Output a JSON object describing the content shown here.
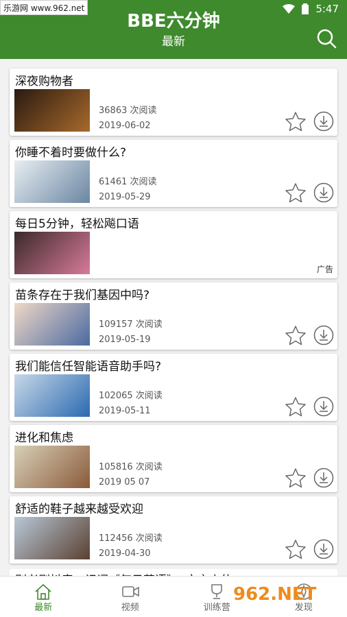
{
  "status_bar": {
    "watermark": "乐游网 www.962.net",
    "time": "5:47"
  },
  "header": {
    "title": "BBE六分钟",
    "subtitle": "最新",
    "search_icon": "search-icon"
  },
  "articles": [
    {
      "title": "深夜购物者",
      "reads": "36863 次阅读",
      "date": "2019-06-02",
      "thumb": [
        "#2a1a12",
        "#a86a2a"
      ]
    },
    {
      "title": "你睡不着时要做什么?",
      "reads": "61461 次阅读",
      "date": "2019-05-29",
      "thumb": [
        "#e8eef2",
        "#6a86a2"
      ]
    },
    {
      "title": "每日5分钟，轻松飚口语",
      "ad": "广告",
      "thumb": [
        "#3a2a2a",
        "#d87a9a"
      ]
    },
    {
      "title": "苗条存在于我们基因中吗?",
      "reads": "109157 次阅读",
      "date": "2019-05-19",
      "thumb": [
        "#f0d8c8",
        "#4a6aa0"
      ]
    },
    {
      "title": "我们能信任智能语音助手吗?",
      "reads": "102065 次阅读",
      "date": "2019-05-11",
      "thumb": [
        "#c8d8e8",
        "#2a6ab0"
      ]
    },
    {
      "title": "进化和焦虑",
      "reads": "105816 次阅读",
      "date": "2019 05 07",
      "thumb": [
        "#d8d0b8",
        "#8a5a3a"
      ]
    },
    {
      "title": "舒适的鞋子越来越受欢迎",
      "reads": "112456 次阅读",
      "date": "2019-04-30",
      "thumb": [
        "#b8c8d8",
        "#5a4030"
      ]
    }
  ],
  "partial_title": "别老刷抖音，记词《每日英语》..文言小伙",
  "tabs": [
    {
      "label": "最新",
      "icon": "home-icon",
      "active": true
    },
    {
      "label": "视频",
      "icon": "video-icon"
    },
    {
      "label": "训练营",
      "icon": "trophy-icon"
    },
    {
      "label": "发现",
      "icon": "discover-icon"
    }
  ],
  "brand_watermark": "962.NET",
  "colors": {
    "primary": "#3e8a2d"
  }
}
